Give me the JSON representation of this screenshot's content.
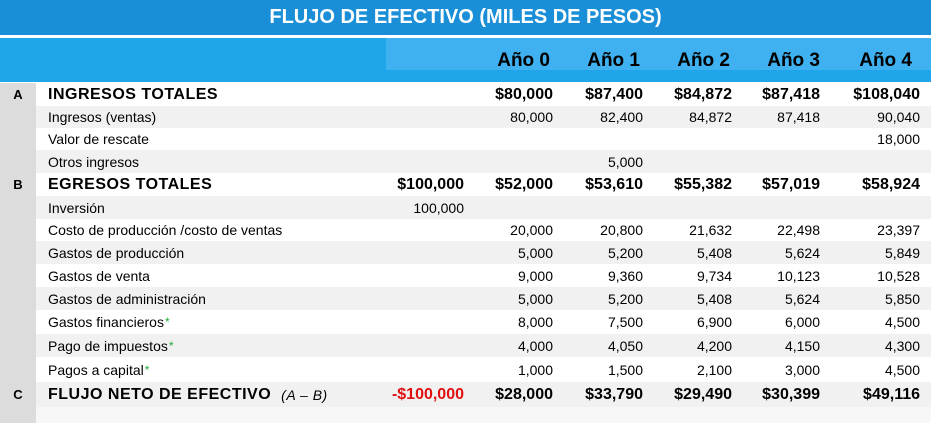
{
  "title": "FLUJO DE EFECTIVO (MILES DE PESOS)",
  "headers": [
    "Año 0",
    "Año 1",
    "Año 2",
    "Año 3",
    "Año 4"
  ],
  "rows": [
    {
      "letter": "A",
      "label": "INGRESOS TOTALES",
      "bold": true,
      "pre": "",
      "values": [
        "$80,000",
        "$87,400",
        "$84,872",
        "$87,418",
        "$108,040"
      ]
    },
    {
      "letter": "",
      "label": "Ingresos (ventas)",
      "bold": false,
      "pre": "",
      "values": [
        "80,000",
        "82,400",
        "84,872",
        "87,418",
        "90,040"
      ]
    },
    {
      "letter": "",
      "label": "Valor de rescate",
      "bold": false,
      "pre": "",
      "values": [
        "",
        "",
        "",
        "",
        "18,000"
      ]
    },
    {
      "letter": "",
      "label": "Otros ingresos",
      "bold": false,
      "pre": "",
      "values": [
        "",
        "5,000",
        "",
        "",
        ""
      ]
    },
    {
      "letter": "B",
      "label": "EGRESOS TOTALES",
      "bold": true,
      "pre": "$100,000",
      "values": [
        "$52,000",
        "$53,610",
        "$55,382",
        "$57,019",
        "$58,924"
      ]
    },
    {
      "letter": "",
      "label": "Inversión",
      "bold": false,
      "pre": "100,000",
      "values": [
        "",
        "",
        "",
        "",
        ""
      ]
    },
    {
      "letter": "",
      "label": "Costo de producción /costo de ventas",
      "bold": false,
      "pre": "",
      "values": [
        "20,000",
        "20,800",
        "21,632",
        "22,498",
        "23,397"
      ]
    },
    {
      "letter": "",
      "label": "Gastos de producción",
      "bold": false,
      "pre": "",
      "values": [
        "5,000",
        "5,200",
        "5,408",
        "5,624",
        "5,849"
      ]
    },
    {
      "letter": "",
      "label": "Gastos de venta",
      "bold": false,
      "pre": "",
      "values": [
        "9,000",
        "9,360",
        "9,734",
        "10,123",
        "10,528"
      ]
    },
    {
      "letter": "",
      "label": "Gastos de administración",
      "bold": false,
      "pre": "",
      "values": [
        "5,000",
        "5,200",
        "5,408",
        "5,624",
        "5,850"
      ]
    },
    {
      "letter": "",
      "label": "Gastos financieros",
      "star": "*",
      "bold": false,
      "pre": "",
      "values": [
        "8,000",
        "7,500",
        "6,900",
        "6,000",
        "4,500"
      ]
    },
    {
      "letter": "",
      "label": "Pago de impuestos",
      "star": "*",
      "bold": false,
      "pre": "",
      "values": [
        "4,000",
        "4,050",
        "4,200",
        "4,150",
        "4,300"
      ]
    },
    {
      "letter": "",
      "label": "Pagos a capital",
      "star": "*",
      "bold": false,
      "pre": "",
      "values": [
        "1,000",
        "1,500",
        "2,100",
        "3,000",
        "4,500"
      ]
    },
    {
      "letter": "C",
      "label": "FLUJO NETO DE EFECTIVO",
      "formula": "(A – B)",
      "bold": true,
      "pre": "-$100,000",
      "preNegative": true,
      "values": [
        "$28,000",
        "$33,790",
        "$29,490",
        "$30,399",
        "$49,116"
      ]
    }
  ],
  "colors": {
    "title_bg": "#1a8fd8",
    "header_bg": "#1fa6ea",
    "negative": "#e01010",
    "star": "#1faa3a"
  }
}
